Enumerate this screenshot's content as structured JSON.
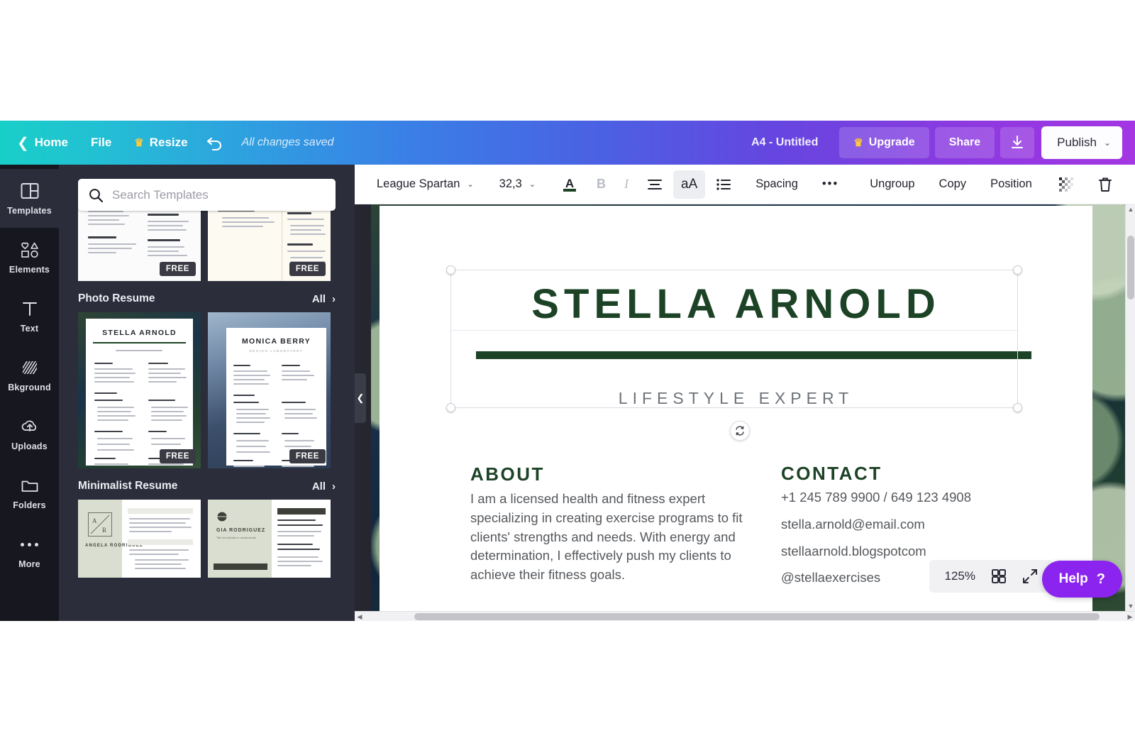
{
  "topbar": {
    "home_label": "Home",
    "file_label": "File",
    "resize_label": "Resize",
    "undo_icon": "undo-arrow-icon",
    "status_text": "All changes saved",
    "doc_title": "A4 - Untitled",
    "upgrade_label": "Upgrade",
    "upgrade_icon": "crown-icon",
    "share_label": "Share",
    "download_icon": "download-icon",
    "publish_label": "Publish",
    "publish_caret": "⌄",
    "gradient_from": "#18cfc8",
    "gradient_to": "#a436e3"
  },
  "rail": {
    "items": [
      {
        "label": "Templates",
        "icon": "templates-icon",
        "active": true
      },
      {
        "label": "Elements",
        "icon": "elements-icon",
        "active": false
      },
      {
        "label": "Text",
        "icon": "text-icon",
        "active": false
      },
      {
        "label": "Bkground",
        "icon": "background-icon",
        "active": false
      },
      {
        "label": "Uploads",
        "icon": "uploads-cloud-icon",
        "active": false
      },
      {
        "label": "Folders",
        "icon": "folder-icon",
        "active": false
      },
      {
        "label": "More",
        "icon": "more-dots-icon",
        "active": false
      }
    ]
  },
  "panel": {
    "search_placeholder": "Search Templates",
    "search_value": "",
    "search_icon": "search-icon",
    "sections": [
      {
        "title": "Photo Resume",
        "all_label": "All",
        "all_caret": "›",
        "cards": [
          {
            "name": "STELLA ARNOLD",
            "badge": "FREE"
          },
          {
            "name": "MONICA BERRY",
            "badge": "FREE"
          }
        ]
      },
      {
        "title": "Minimalist Resume",
        "all_label": "All",
        "all_caret": "›",
        "cards": [
          {
            "name": "ANGELA RODRIGUEZ",
            "badge": ""
          },
          {
            "name": "GIA RODRIGUEZ",
            "badge": ""
          }
        ]
      }
    ],
    "top_cards": [
      {
        "badge": "FREE"
      },
      {
        "badge": "FREE"
      }
    ]
  },
  "toolbar": {
    "font_family": "League Spartan",
    "font_family_caret": "⌄",
    "font_size": "32,3",
    "font_size_caret": "⌄",
    "text_color_icon": "text-color-a-icon",
    "bold_label": "B",
    "italic_label": "I",
    "align_icon": "align-icon",
    "case_label": "aA",
    "list_icon": "bullet-list-icon",
    "spacing_label": "Spacing",
    "more_label": "•••",
    "ungroup_label": "Ungroup",
    "copy_label": "Copy",
    "position_label": "Position",
    "transparency_icon": "transparency-icon",
    "delete_icon": "trash-icon",
    "text_color_value": "#1d4326"
  },
  "canvas": {
    "name": "STELLA ARNOLD",
    "subtitle": "LIFESTYLE EXPERT",
    "about_heading": "ABOUT",
    "about_body": "I am a licensed health and fitness expert specializing in creating exercise programs to fit clients' strengths and needs. With energy and determination, I effectively push my clients to achieve their fitness goals.",
    "contact_heading": "CONTACT",
    "contact_lines": [
      "+1 245 789 9900 / 649 123 4908",
      "stella.arnold@email.com",
      "stellaarnold.blogspotcom",
      "@stellaexercises"
    ],
    "accent_color": "#1d4326",
    "rotate_icon": "rotate-icon",
    "collapse_icon": "chevron-left-icon"
  },
  "footer": {
    "zoom_level": "125%",
    "grid_icon": "grid-view-icon",
    "fullscreen_icon": "expand-icon",
    "help_label": "Help",
    "help_mark": "?",
    "help_color": "#8b24ef"
  }
}
